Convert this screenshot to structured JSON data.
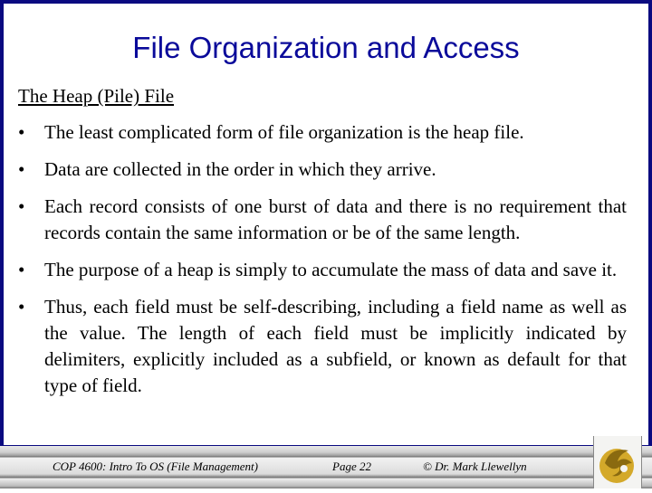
{
  "slide": {
    "title": "File Organization and Access",
    "subtitle": "The Heap (Pile) File",
    "bullets": [
      "The least complicated form of file organization is the heap file.",
      "Data are collected in the order in which they arrive.",
      "Each record consists of one burst of data and there is no requirement that records contain the same information or be of the same length.",
      "The purpose of a heap is simply to accumulate the mass of data and save it.",
      "Thus, each field must be self-describing, including a field name as well as the value. The length of each field must be implicitly indicated by delimiters, explicitly included as a subfield, or known as default for that type of field."
    ],
    "bullet_glyph": "•"
  },
  "footer": {
    "course": "COP 4600: Intro To OS  (File Management)",
    "page": "Page 22",
    "copyright": "© Dr. Mark Llewellyn",
    "logo_icon": "pegasus-logo-icon"
  },
  "colors": {
    "border": "#0a0a80",
    "title": "#0a0a9a",
    "logo_gold": "#d4a92a"
  }
}
